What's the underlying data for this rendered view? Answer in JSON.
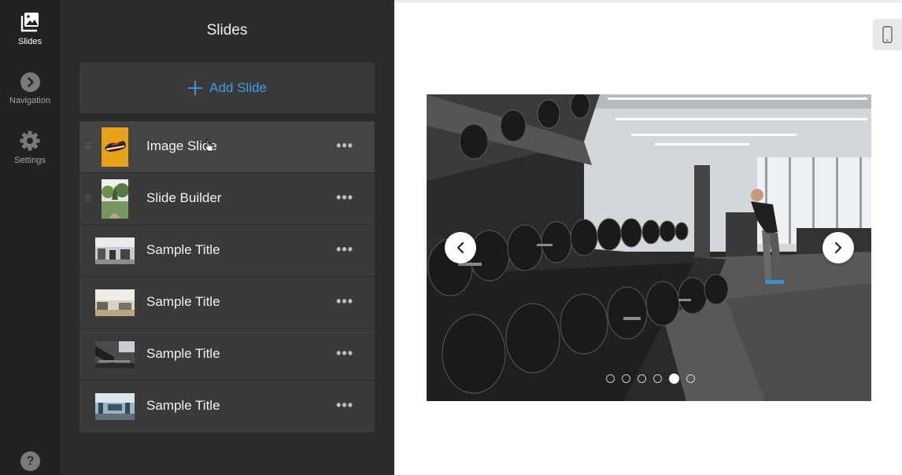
{
  "rail": {
    "items": [
      {
        "label": "Slides",
        "icon": "slides-icon",
        "active": true
      },
      {
        "label": "Navigation",
        "icon": "navigation-icon",
        "active": false
      },
      {
        "label": "Settings",
        "icon": "gear-icon",
        "active": false
      }
    ],
    "help_label": "?"
  },
  "panel": {
    "title": "Slides",
    "add_slide_label": "Add Slide",
    "add_icon": "plus-icon",
    "slides": [
      {
        "name": "Image Slide",
        "more": "•••",
        "thumb": "sneaker-image"
      },
      {
        "name": "Slide Builder",
        "more": "•••",
        "thumb": "garden-image"
      },
      {
        "name": "Sample Title",
        "more": "•••",
        "thumb": "gym-image"
      },
      {
        "name": "Sample Title",
        "more": "•••",
        "thumb": "gym-image"
      },
      {
        "name": "Sample Title",
        "more": "•••",
        "thumb": "gym-image"
      },
      {
        "name": "Sample Title",
        "more": "•••",
        "thumb": "gym-image"
      }
    ]
  },
  "preview": {
    "device_icon": "mobile-device-icon",
    "image": "gym-dumbbell-rack-photo",
    "prev_icon": "chevron-left-icon",
    "next_icon": "chevron-right-icon",
    "dot_count": 6,
    "active_dot": 5
  },
  "colors": {
    "rail_bg": "#222222",
    "panel_bg": "#2b2b2b",
    "row_bg": "#3a3a3a",
    "accent": "#3f9be6"
  }
}
